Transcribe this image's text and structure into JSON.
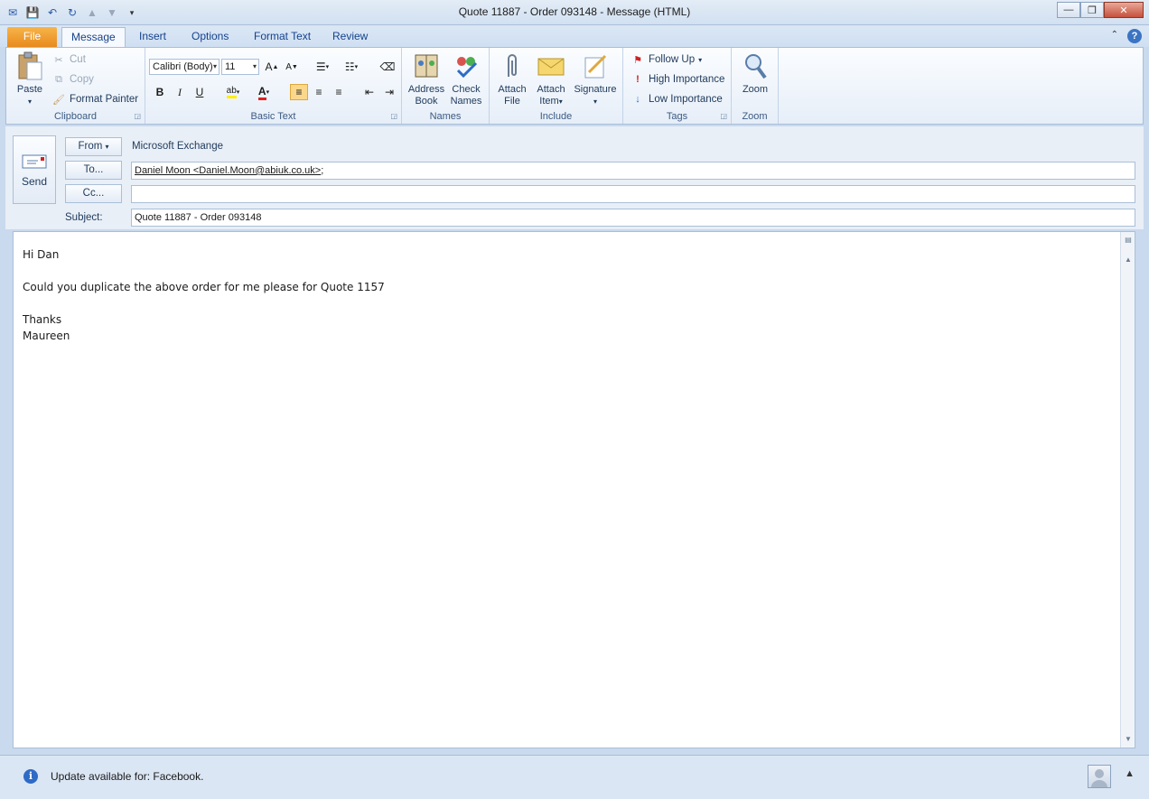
{
  "window": {
    "title": "Quote 11887  -  Order 093148  -  Message (HTML)"
  },
  "tabs": [
    {
      "label": "File"
    },
    {
      "label": "Message"
    },
    {
      "label": "Insert"
    },
    {
      "label": "Options"
    },
    {
      "label": "Format Text"
    },
    {
      "label": "Review"
    }
  ],
  "ribbon": {
    "clipboard": {
      "label": "Clipboard",
      "paste": "Paste",
      "cut": "Cut",
      "copy": "Copy",
      "format_painter": "Format Painter"
    },
    "basic_text": {
      "label": "Basic Text",
      "font": "Calibri (Body)",
      "size": "11",
      "bold": "B",
      "italic": "I",
      "underline": "U"
    },
    "names": {
      "label": "Names",
      "address_book_line1": "Address",
      "address_book_line2": "Book",
      "check_names_line1": "Check",
      "check_names_line2": "Names"
    },
    "include": {
      "label": "Include",
      "attach_file_line1": "Attach",
      "attach_file_line2": "File",
      "attach_item_line1": "Attach",
      "attach_item_line2": "Item",
      "signature": "Signature"
    },
    "tags": {
      "label": "Tags",
      "follow_up": "Follow Up",
      "high_importance": "High Importance",
      "low_importance": "Low Importance"
    },
    "zoom": {
      "label": "Zoom",
      "zoom": "Zoom"
    }
  },
  "header": {
    "send": "Send",
    "from_button": "From",
    "from_value": "Microsoft Exchange",
    "to_button": "To...",
    "to_value": "Daniel Moon <Daniel.Moon@abiuk.co.uk>",
    "to_suffix": ";",
    "cc_button": "Cc...",
    "cc_value": "",
    "subject_label": "Subject:",
    "subject_value": "Quote 11887 -  Order 093148"
  },
  "body": {
    "lines": [
      "Hi Dan",
      "",
      "Could you duplicate the above order for me please for Quote 1157",
      "",
      "Thanks",
      "Maureen"
    ]
  },
  "statusbar": {
    "text": "Update available for: Facebook."
  },
  "colors": {
    "file_tab": "#e88a1b",
    "accent": "#2e6bc6",
    "ribbon_bg": "#e6eef8"
  }
}
